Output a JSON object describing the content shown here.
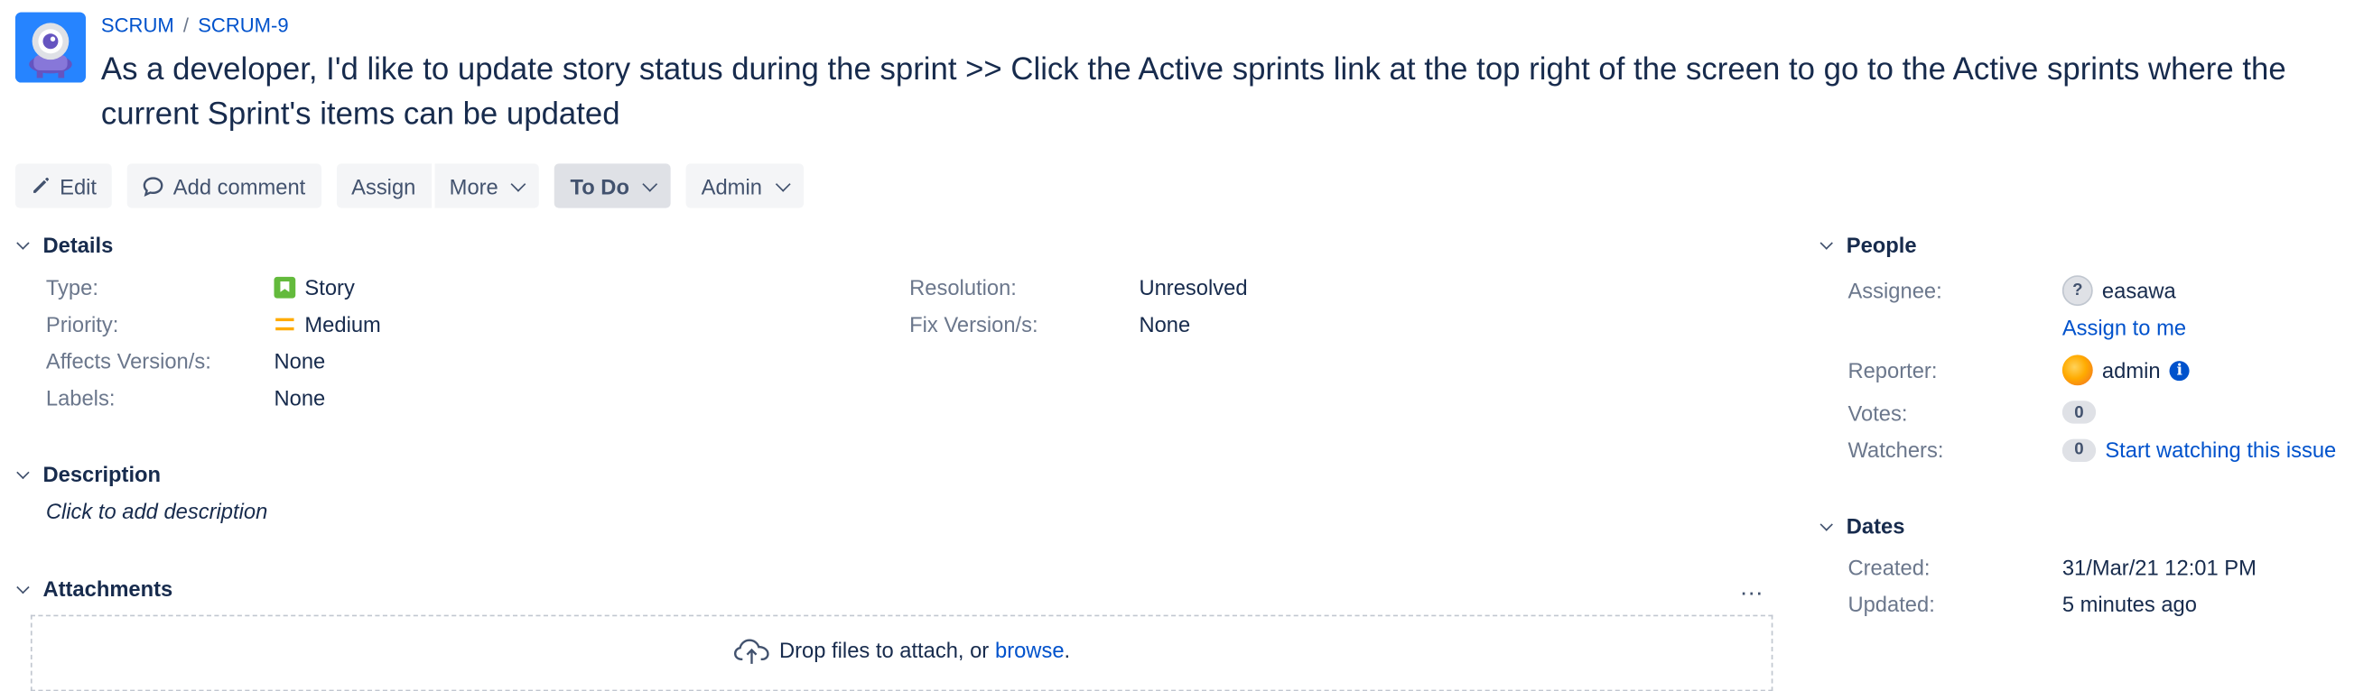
{
  "breadcrumb": {
    "project": "SCRUM",
    "separator": "/",
    "issue_key": "SCRUM-9"
  },
  "summary": "As a developer, I'd like to update story status during the sprint >> Click the Active sprints link at the top right of the screen to go to the Active sprints where the current Sprint's items can be updated",
  "toolbar": {
    "edit": "Edit",
    "add_comment": "Add comment",
    "assign": "Assign",
    "more": "More",
    "status": "To Do",
    "admin": "Admin"
  },
  "details": {
    "title": "Details",
    "type_label": "Type:",
    "type_value": "Story",
    "priority_label": "Priority:",
    "priority_value": "Medium",
    "affects_label": "Affects Version/s:",
    "affects_value": "None",
    "labels_label": "Labels:",
    "labels_value": "None",
    "resolution_label": "Resolution:",
    "resolution_value": "Unresolved",
    "fix_label": "Fix Version/s:",
    "fix_value": "None"
  },
  "description": {
    "title": "Description",
    "placeholder": "Click to add description"
  },
  "attachments": {
    "title": "Attachments",
    "more": "…",
    "drop_text": "Drop files to attach, or",
    "browse": "browse",
    "period": "."
  },
  "people": {
    "title": "People",
    "assignee_label": "Assignee:",
    "assignee_value": "easawa",
    "assign_to_me": "Assign to me",
    "reporter_label": "Reporter:",
    "reporter_value": "admin",
    "votes_label": "Votes:",
    "votes_value": "0",
    "watchers_label": "Watchers:",
    "watchers_value": "0",
    "watch_link": "Start watching this issue"
  },
  "dates": {
    "title": "Dates",
    "created_label": "Created:",
    "created_value": "31/Mar/21 12:01 PM",
    "updated_label": "Updated:",
    "updated_value": "5 minutes ago"
  },
  "icons": {
    "project": "project-avatar-icon",
    "edit": "pencil-icon",
    "comment": "comment-icon",
    "type": "story-icon",
    "priority": "priority-medium-icon",
    "upload": "cloud-upload-icon",
    "info": "info-icon"
  },
  "colors": {
    "link": "#0052cc",
    "text": "#172b4d",
    "muted": "#6b778c",
    "story": "#63ba3c",
    "priority_medium": "#ffab00"
  }
}
